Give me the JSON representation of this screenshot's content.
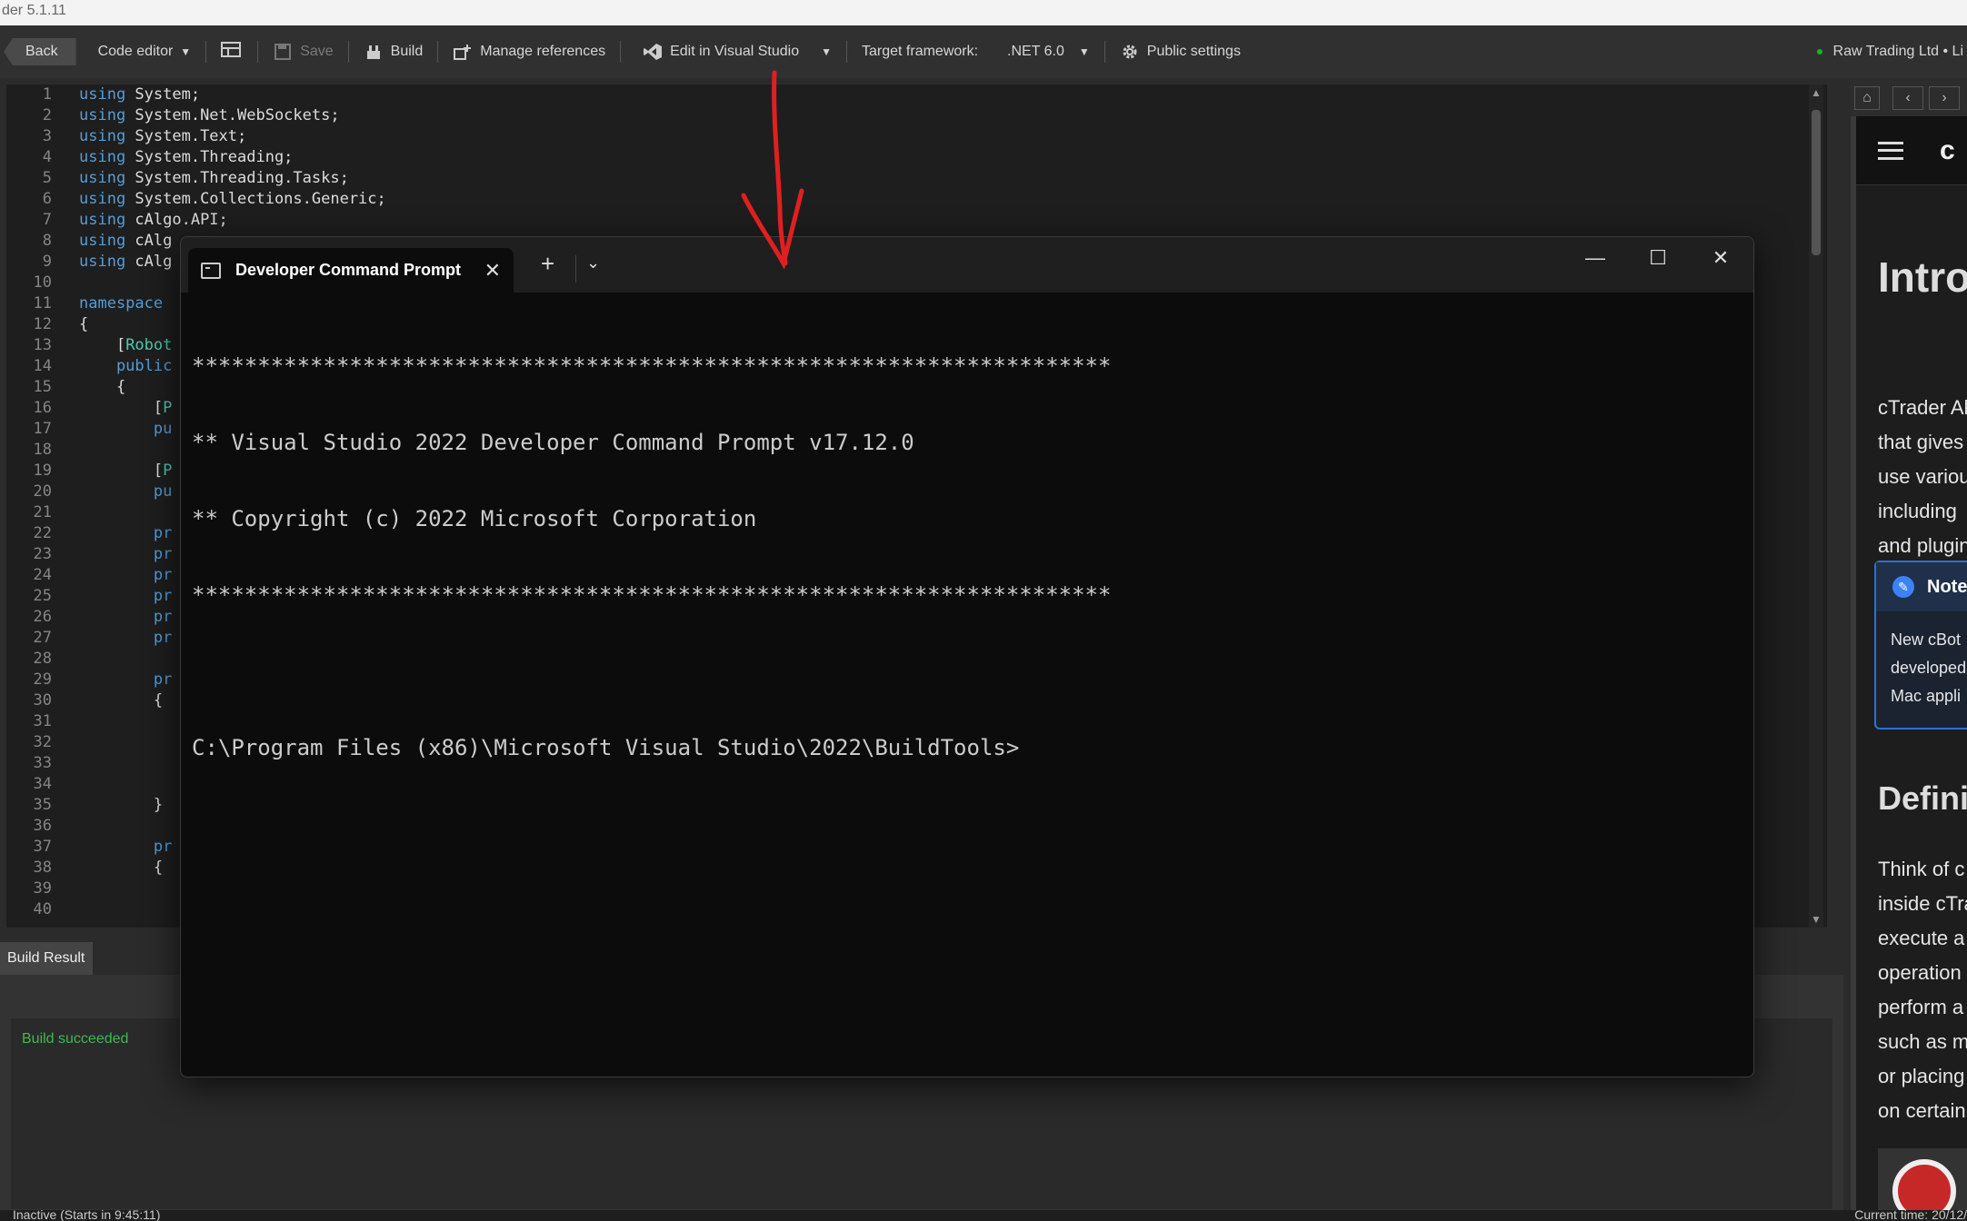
{
  "app": {
    "title_fragment": "der 5.1.11"
  },
  "toolbar": {
    "back_label": "Back",
    "code_editor_label": "Code editor",
    "save_label": "Save",
    "build_label": "Build",
    "manage_refs_label": "Manage references",
    "edit_vs_label": "Edit in Visual Studio",
    "target_framework_label": "Target framework:",
    "framework_value": ".NET 6.0",
    "public_settings_label": "Public settings",
    "account_label": "Raw Trading Ltd • Li"
  },
  "editor": {
    "line_numbers": [
      "1",
      "2",
      "3",
      "4",
      "5",
      "6",
      "7",
      "8",
      "9",
      "10",
      "11",
      "12",
      "13",
      "14",
      "15",
      "16",
      "17",
      "18",
      "19",
      "20",
      "21",
      "22",
      "23",
      "24",
      "25",
      "26",
      "27",
      "28",
      "29",
      "30",
      "31",
      "32",
      "33",
      "34",
      "35",
      "36",
      "37",
      "38",
      "39",
      "40"
    ],
    "lines": [
      [
        [
          "kw",
          "using"
        ],
        [
          "",
          "System;"
        ]
      ],
      [
        [
          "kw",
          "using"
        ],
        [
          "",
          "System.Net.WebSockets;"
        ]
      ],
      [
        [
          "kw",
          "using"
        ],
        [
          "",
          "System.Text;"
        ]
      ],
      [
        [
          "kw",
          "using"
        ],
        [
          "",
          "System.Threading;"
        ]
      ],
      [
        [
          "kw",
          "using"
        ],
        [
          "",
          "System.Threading.Tasks;"
        ]
      ],
      [
        [
          "kw",
          "using"
        ],
        [
          "",
          "System.Collections.Generic;"
        ]
      ],
      [
        [
          "kw",
          "using"
        ],
        [
          "",
          "cAlgo.API;"
        ]
      ],
      [
        [
          "kw",
          "using"
        ],
        [
          "",
          "cAlg"
        ]
      ],
      [
        [
          "kw",
          "using"
        ],
        [
          "",
          "cAlg"
        ]
      ],
      [],
      [
        [
          "kw",
          "namespace"
        ]
      ],
      [
        [
          "",
          "{"
        ]
      ],
      [
        [
          "",
          "    ["
        ],
        [
          "ty",
          "Robot"
        ]
      ],
      [
        [
          "kw",
          "    public"
        ]
      ],
      [
        [
          "",
          "    {"
        ]
      ],
      [
        [
          "",
          "        ["
        ],
        [
          "ty",
          "P"
        ]
      ],
      [
        [
          "kw",
          "        pu"
        ]
      ],
      [],
      [
        [
          "",
          "        ["
        ],
        [
          "ty",
          "P"
        ]
      ],
      [
        [
          "kw",
          "        pu"
        ]
      ],
      [],
      [
        [
          "kw",
          "        pr"
        ]
      ],
      [
        [
          "kw",
          "        pr"
        ]
      ],
      [
        [
          "kw",
          "        pr"
        ]
      ],
      [
        [
          "kw",
          "        pr"
        ]
      ],
      [
        [
          "kw",
          "        pr"
        ]
      ],
      [
        [
          "kw",
          "        pr"
        ]
      ],
      [],
      [
        [
          "kw",
          "        pr"
        ]
      ],
      [
        [
          "",
          "        {"
        ]
      ],
      [],
      [],
      [],
      [],
      [
        [
          "",
          "        }"
        ]
      ],
      [],
      [
        [
          "kw",
          "        pr"
        ]
      ],
      [
        [
          "",
          "        {"
        ]
      ],
      [],
      []
    ]
  },
  "build": {
    "tab_label": "Build Result",
    "message": "Build succeeded"
  },
  "status": {
    "left": "Inactive (Starts in 9:45:11)",
    "right": "Current time: 20/12/"
  },
  "doc_panel": {
    "logo": "c",
    "heading": "Intro",
    "paragraph_lines": [
      "cTrader Al",
      "that gives",
      "use variou",
      "including",
      "and plugin"
    ],
    "note_title": "Note",
    "note_lines": [
      "New cBot",
      "developed",
      "Mac appli"
    ],
    "heading2": "Defini",
    "paragraph2_lines": [
      "Think of c",
      "inside cTra",
      "execute a",
      "operation",
      "perform a",
      "such as m",
      "or placing",
      "on certain"
    ]
  },
  "terminal": {
    "tab_title": "Developer Command Prompt",
    "lines": [
      "**********************************************************************",
      "** Visual Studio 2022 Developer Command Prompt v17.12.0",
      "** Copyright (c) 2022 Microsoft Corporation",
      "**********************************************************************",
      "",
      "C:\\Program Files (x86)\\Microsoft Visual Studio\\2022\\BuildTools>"
    ]
  },
  "colors": {
    "annotation_arrow": "#e02020",
    "build_success": "#3fb950",
    "keyword": "#569cd6",
    "type": "#4ec9b0"
  }
}
